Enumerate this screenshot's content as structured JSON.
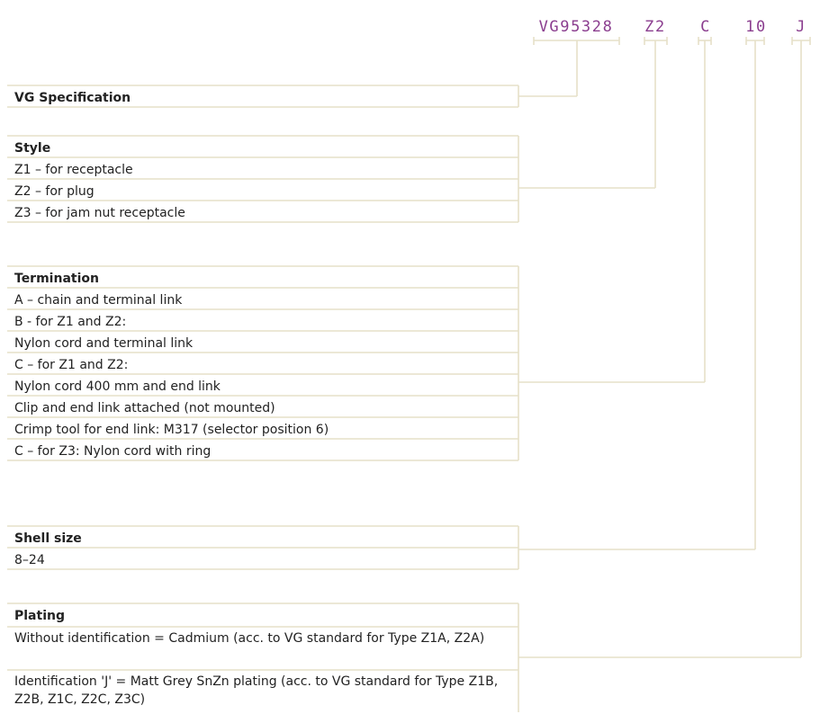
{
  "code": [
    "VG95328",
    "Z2",
    "C",
    "10",
    "J"
  ],
  "groups": [
    {
      "title": "VG Specification",
      "rows": []
    },
    {
      "title": "Style",
      "rows": [
        "Z1 – for receptacle",
        "Z2 – for plug",
        "Z3 – for jam nut receptacle"
      ]
    },
    {
      "title": "Termination",
      "rows": [
        "A – chain and terminal link",
        "B - for Z1 and Z2:",
        "Nylon cord and terminal link",
        "C – for Z1 and Z2:",
        "Nylon cord 400 mm and end link",
        "Clip and end link attached (not mounted)",
        "Crimp tool for end link: M317 (selector position 6)",
        "C – for Z3: Nylon cord with ring"
      ]
    },
    {
      "title": "Shell size",
      "rows": [
        "8–24"
      ]
    },
    {
      "title": "Plating",
      "rows": [
        "Without identification = Cadmium (acc. to VG standard for Type Z1A, Z2A)",
        "Identification 'J' = Matt Grey SnZn plating (acc. to VG standard for Type Z1B, Z2B, Z1C, Z2C, Z3C)"
      ]
    }
  ],
  "colors": {
    "code": "#8b3e8f",
    "line": "#e6e0c8",
    "text": "#222222"
  }
}
